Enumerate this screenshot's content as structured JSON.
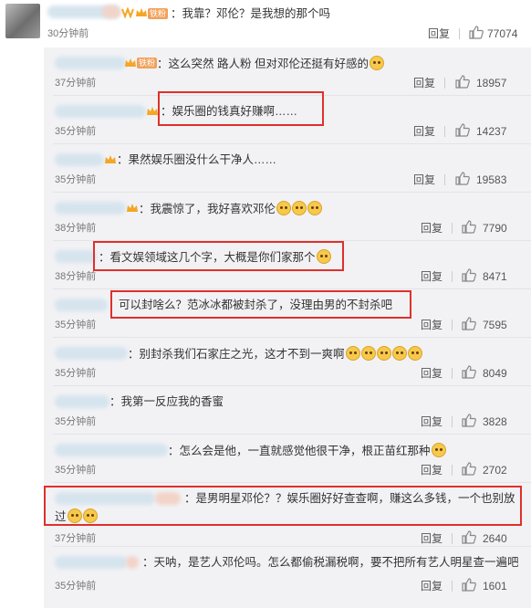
{
  "top": {
    "fan_badge": "铁粉",
    "text": "：我靠？邓伦？是我想的那个吗",
    "time": "30分钟前",
    "reply": "回复",
    "likes": "77074"
  },
  "replies": [
    {
      "badge": "铁粉",
      "text": "：这么突然 路人粉 但对邓伦还挺有好感的",
      "emoji_count": 1,
      "time": "37分钟前",
      "reply": "回复",
      "likes": "18957"
    },
    {
      "badge": "",
      "text": "：娱乐圈的钱真好赚啊……",
      "emoji_count": 0,
      "time": "35分钟前",
      "reply": "回复",
      "likes": "14237"
    },
    {
      "badge": "",
      "text": "：果然娱乐圈没什么干净人……",
      "emoji_count": 0,
      "time": "35分钟前",
      "reply": "回复",
      "likes": "19583"
    },
    {
      "badge": "",
      "text": "：我震惊了，我好喜欢邓伦",
      "emoji_count": 3,
      "time": "38分钟前",
      "reply": "回复",
      "likes": "7790"
    },
    {
      "badge": "",
      "text": "：看文娱领域这几个字，大概是你们家那个",
      "emoji_count": 1,
      "time": "38分钟前",
      "reply": "回复",
      "likes": "8471"
    },
    {
      "badge": "",
      "text": "可以封啥么？范冰冰都被封杀了，没理由男的不封杀吧",
      "emoji_count": 0,
      "time": "35分钟前",
      "reply": "回复",
      "likes": "7595"
    },
    {
      "badge": "",
      "text": "：别封杀我们石家庄之光，这才不到一爽啊",
      "emoji_count": 5,
      "time": "35分钟前",
      "reply": "回复",
      "likes": "8049"
    },
    {
      "badge": "",
      "text": "：我第一反应我的香蜜",
      "emoji_count": 0,
      "time": "35分钟前",
      "reply": "回复",
      "likes": "3828"
    },
    {
      "badge": "",
      "text": "：怎么会是他，一直就感觉他很干净，根正苗红那种",
      "emoji_count": 1,
      "time": "35分钟前",
      "reply": "回复",
      "likes": "2702"
    },
    {
      "badge": "",
      "text": "：是男明星邓伦？？娱乐圈好好查查啊，赚这么多钱，一个也别放",
      "text2": "过",
      "emoji_count": 2,
      "time": "37分钟前",
      "reply": "回复",
      "likes": "2640"
    },
    {
      "badge": "",
      "text": "：天呐，是艺人邓伦吗。怎么都偷税漏税啊，要不把所有艺人明星查一遍吧",
      "emoji_count": 0,
      "time": "35分钟前",
      "reply": "回复",
      "likes": "1601"
    }
  ],
  "colors": {
    "highlight_border": "#e0302a",
    "reply_bg": "#f2f2f5",
    "emoji": "#f7c94b"
  }
}
